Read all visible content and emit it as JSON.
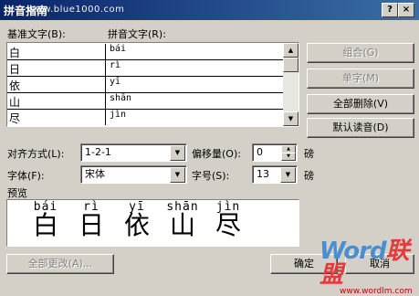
{
  "window": {
    "title": "拼音指南",
    "watermark_top": "www.blue1000.com",
    "help": "?",
    "close": "×"
  },
  "labels": {
    "base_text": "基准文字(B):",
    "pinyin_text": "拼音文字(R):",
    "alignment": "对齐方式(L):",
    "offset": "偏移量(O):",
    "font": "字体(F):",
    "size": "字号(S):",
    "preview": "预览",
    "unit_offset": "磅",
    "unit_size": "磅"
  },
  "rows": [
    {
      "base": "白",
      "pinyin": "bái"
    },
    {
      "base": "日",
      "pinyin": "rì"
    },
    {
      "base": "依",
      "pinyin": "yī"
    },
    {
      "base": "山",
      "pinyin": "shān"
    },
    {
      "base": "尽",
      "pinyin": "jìn"
    }
  ],
  "buttons": {
    "combine": "组合(G)",
    "single_char": "单字(M)",
    "delete_all": "全部删除(V)",
    "default_reading": "默认读音(D)",
    "change_all": "全部更改(A)...",
    "ok": "确定",
    "cancel": "取消"
  },
  "fields": {
    "alignment": "1-2-1",
    "offset": "0",
    "font": "宋体",
    "size": "13"
  },
  "preview": {
    "pinyin": [
      "bái",
      "rì",
      "yī",
      "shān",
      "jìn"
    ],
    "hanzi": [
      "白",
      "日",
      "依",
      "山",
      "尽"
    ]
  },
  "watermark": {
    "brand": "Word",
    "brand2": "联盟",
    "url": "www.wordlm.com"
  }
}
